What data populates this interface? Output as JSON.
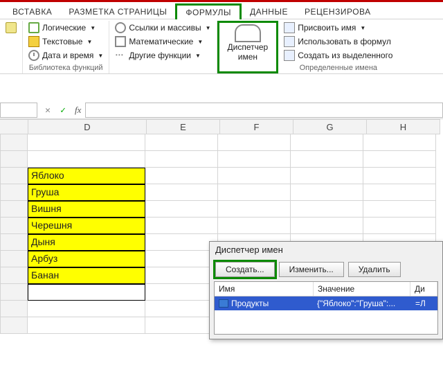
{
  "tabs": {
    "insert": "ВСТАВКА",
    "layout": "РАЗМЕТКА СТРАНИЦЫ",
    "formulas": "ФОРМУЛЫ",
    "data": "ДАННЫЕ",
    "review": "РЕЦЕНЗИРОВА"
  },
  "ribbon": {
    "logic": "Логические",
    "text": "Текстовые",
    "datetime": "Дата и время",
    "lookup": "Ссылки и массивы",
    "math": "Математические",
    "more": "Другие функции",
    "lib_group": "Библиотека функций",
    "name_mgr_l1": "Диспетчер",
    "name_mgr_l2": "имен",
    "def_name": "Присвоить имя",
    "use_formula": "Использовать в формул",
    "from_sel": "Создать из выделенного",
    "names_group": "Определенные имена"
  },
  "formula_bar": {
    "cancel": "✕",
    "ok": "✓",
    "fx": "fx",
    "value": ""
  },
  "columns": [
    "",
    "D",
    "E",
    "F",
    "G",
    "H"
  ],
  "cells": {
    "d": [
      "",
      "Яблоко",
      "Груша",
      "Вишня",
      "Черешня",
      "Дыня",
      "Арбуз",
      "Банан",
      ""
    ]
  },
  "dialog": {
    "title": "Диспетчер имен",
    "create": "Создать...",
    "edit": "Изменить...",
    "delete": "Удалить",
    "col_name": "Имя",
    "col_value": "Значение",
    "col_scope": "Ди",
    "row_name": "Продукты",
    "row_value": "{\"Яблоко\":\"Груша\":...",
    "row_scope": "=Л"
  }
}
